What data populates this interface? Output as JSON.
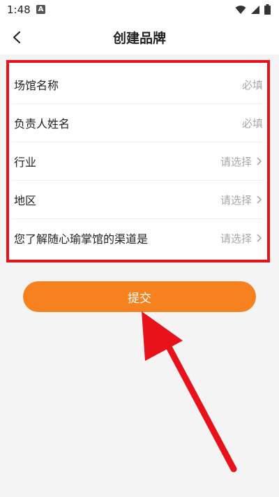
{
  "status": {
    "time": "1:48",
    "notification_badge": "A",
    "icons": [
      "wifi-icon",
      "signal-icon",
      "battery-icon"
    ]
  },
  "header": {
    "title": "创建品牌"
  },
  "form": {
    "rows": [
      {
        "label": "场馆名称",
        "value": "必填",
        "chevron": false
      },
      {
        "label": "负责人姓名",
        "value": "必填",
        "chevron": false
      },
      {
        "label": "行业",
        "value": "请选择",
        "chevron": true
      },
      {
        "label": "地区",
        "value": "请选择",
        "chevron": true
      },
      {
        "label": "您了解随心瑜掌馆的渠道是",
        "value": "请选择",
        "chevron": true
      }
    ]
  },
  "submit": {
    "label": "提交"
  },
  "colors": {
    "accent": "#f5821e",
    "highlight_border": "#e8121a",
    "background": "#f4f4f4"
  }
}
